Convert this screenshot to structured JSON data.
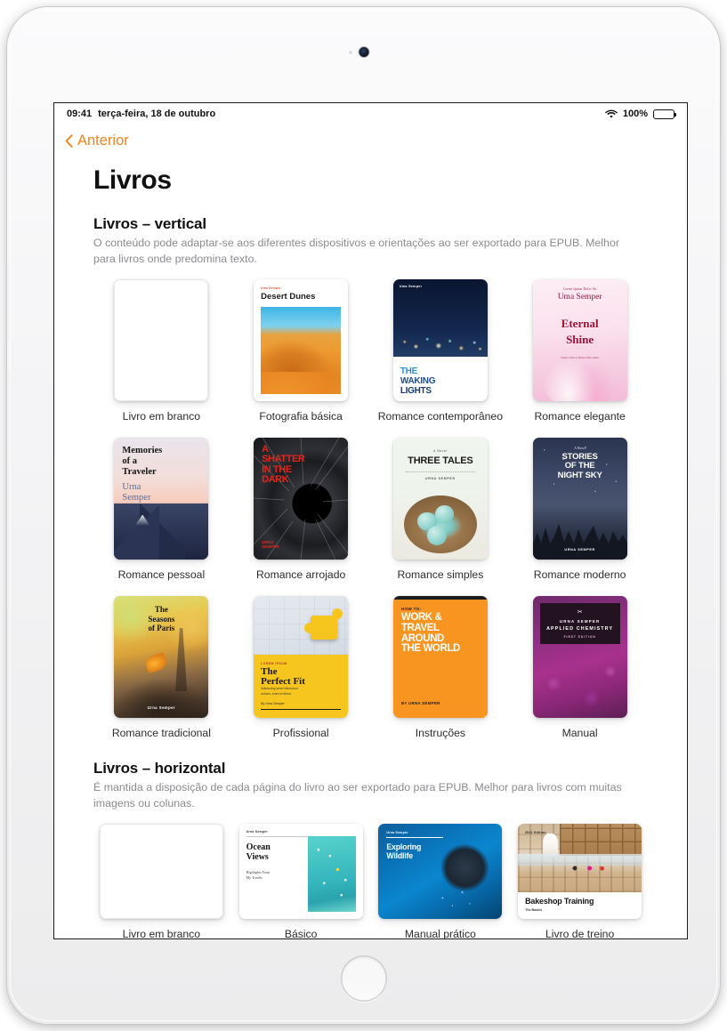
{
  "status_bar": {
    "time": "09:41",
    "date": "terça-feira, 18 de outubro",
    "wifi_icon": "wifi-icon",
    "battery_percent": "100%",
    "battery_level": 100
  },
  "nav": {
    "back_label": "Anterior",
    "back_icon": "chevron-left-icon"
  },
  "page_title": "Livros",
  "sections": [
    {
      "heading": "Livros – vertical",
      "description": "O conteúdo pode adaptar-se aos diferentes dispositivos e orientações ao ser exportado para EPUB. Melhor para livros onde predomina texto.",
      "orientation": "vertical",
      "templates": [
        {
          "label": "Livro em branco",
          "cover": "blank"
        },
        {
          "label": "Fotografia básica",
          "cover": "desert-dunes",
          "cover_text": {
            "author": "Uma Semper",
            "title": "Desert Dunes"
          }
        },
        {
          "label": "Romance contemporâneo",
          "cover": "waking-lights",
          "cover_text": {
            "author": "Uma Semper",
            "t1": "THE",
            "t2": "WAKING",
            "t3": "LIGHTS"
          }
        },
        {
          "label": "Romance elegante",
          "cover": "eternal-shine",
          "cover_text": {
            "pre": "Lorem Ipsum Dolor Sit",
            "name": "Uma Semper",
            "t1": "Eternal",
            "t2": "Shine",
            "sub": "Donec Nisi et Risus Duis Amet"
          }
        },
        {
          "label": "Romance pessoal",
          "cover": "memories-traveler",
          "cover_text": {
            "title": "Memories\nof a\nTraveler",
            "author": "Urna\nSemper"
          }
        },
        {
          "label": "Romance arrojado",
          "cover": "shatter-dark",
          "cover_text": {
            "title": "A\nSHATTER\nIN THE\nDARK",
            "author": "URNA\nSEMPER"
          }
        },
        {
          "label": "Romance simples",
          "cover": "three-tales",
          "cover_text": {
            "pre": "A Novel",
            "title": "THREE TALES",
            "author": "URNA SEMPER"
          }
        },
        {
          "label": "Romance moderno",
          "cover": "night-sky",
          "cover_text": {
            "pre": "A Novel",
            "title": "STORIES\nOF THE\nNIGHT SKY",
            "author": "URNA SEMPER"
          }
        },
        {
          "label": "Romance tradicional",
          "cover": "seasons-paris",
          "cover_text": {
            "title": "The\nSeasons\nof Paris",
            "author": "Urna Semper"
          }
        },
        {
          "label": "Profissional",
          "cover": "perfect-fit",
          "cover_text": {
            "kicker": "LOREM IPSUM",
            "title": "The\nPerfect Fit",
            "sub": "Adipiscing amet bibendum\nnullam, enim et libero",
            "author": "By Urna Semper"
          }
        },
        {
          "label": "Instruções",
          "cover": "how-to-work-travel",
          "cover_text": {
            "kicker": "HOW TO:",
            "title": "WORK &\nTRAVEL\nAROUND\nTHE WORLD",
            "author": "BY URNA SEMPER"
          }
        },
        {
          "label": "Manual",
          "cover": "applied-chemistry",
          "cover_text": {
            "logo": "✂",
            "name": "URNA SEMPER",
            "title": "APPLIED CHEMISTRY",
            "edition": "FIRST EDITION"
          }
        }
      ]
    },
    {
      "heading": "Livros – horizontal",
      "description": "É mantida a disposição de cada página do livro ao ser exportado para EPUB. Melhor para livros com muitas imagens ou colunas.",
      "orientation": "horizontal",
      "templates": [
        {
          "label": "Livro em branco",
          "cover": "blank"
        },
        {
          "label": "Básico",
          "cover": "ocean-views",
          "cover_text": {
            "author": "Urna Semper",
            "title": "Ocean\nViews",
            "sub": "Highlights From\nMy Travels"
          }
        },
        {
          "label": "Manual prático",
          "cover": "exploring-wildlife",
          "cover_text": {
            "author": "Urna Semper",
            "title": "Exploring\nWildlife"
          }
        },
        {
          "label": "Livro de treino",
          "cover": "bakeshop-training",
          "cover_text": {
            "edition": "2021 Edition",
            "title": "Bakeshop Training",
            "sub": "The Basics"
          }
        }
      ]
    }
  ],
  "colors": {
    "accent": "#f08418",
    "title_text": "#111111",
    "body_text": "#8b8b90",
    "label_text": "#2c2c2e",
    "screen_bg": "#ffffff"
  }
}
